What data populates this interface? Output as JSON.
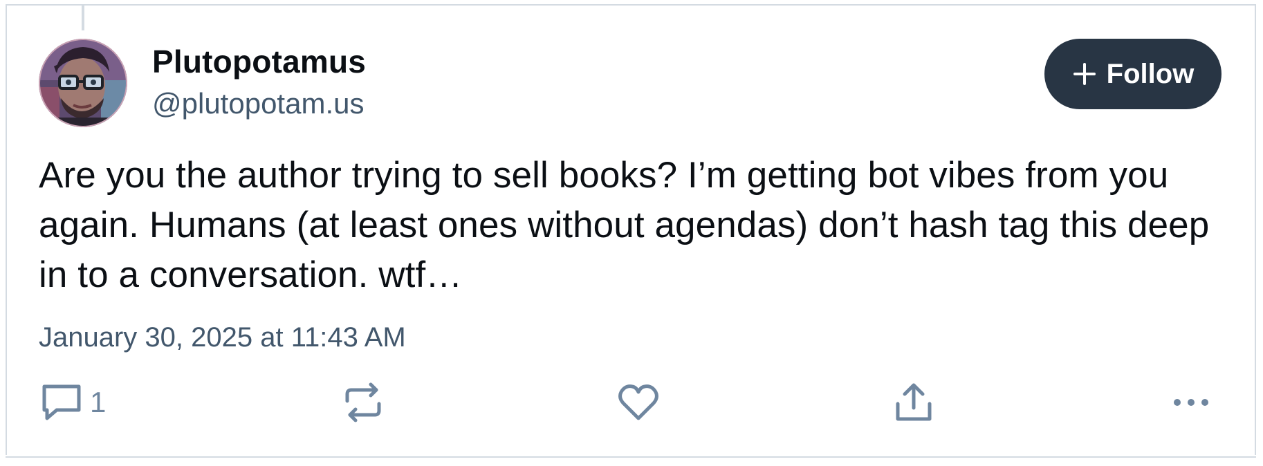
{
  "post": {
    "author": {
      "display_name": "Plutopotamus",
      "handle": "@plutopotam.us",
      "avatar_icon": "avatar-photo"
    },
    "follow_button": {
      "label": "Follow",
      "icon": "plus-icon",
      "background": "#283544"
    },
    "text": "Are you the author trying to sell books? I’m getting bot vibes from you again. Humans (at least ones without agendas) don’t hash tag this deep in to a conversation. wtf…",
    "timestamp": "January 30, 2025 at 11:43 AM",
    "actions": {
      "reply": {
        "icon": "reply-bubble-icon",
        "count": "1"
      },
      "repost": {
        "icon": "repost-icon"
      },
      "like": {
        "icon": "heart-icon"
      },
      "share": {
        "icon": "share-icon"
      },
      "more": {
        "icon": "more-dots-icon"
      }
    }
  },
  "colors": {
    "text_primary": "#0b0f14",
    "text_secondary": "#42576c",
    "icon_muted": "#6f869f",
    "divider": "#d4dbe2"
  }
}
